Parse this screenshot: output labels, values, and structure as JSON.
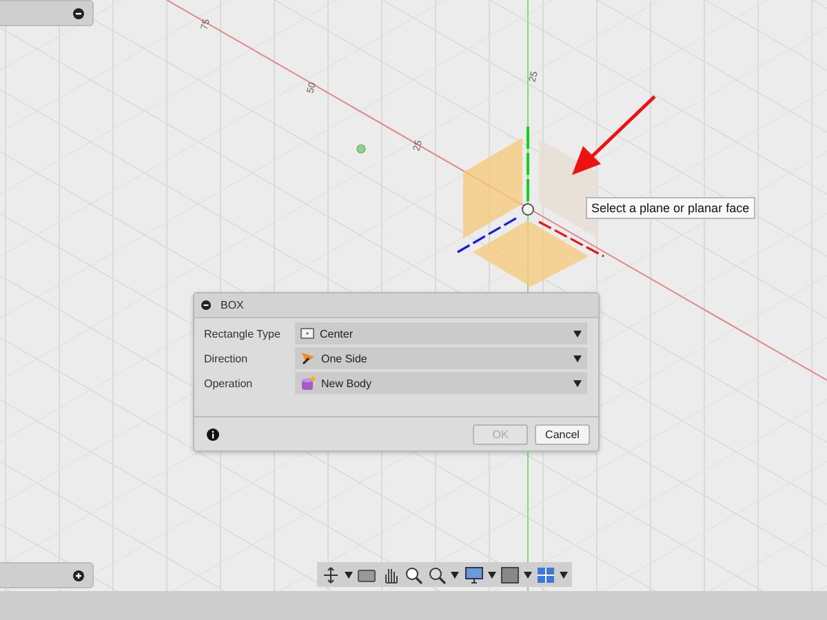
{
  "canvas": {
    "axis_labels": [
      "75",
      "50",
      "25",
      "25"
    ]
  },
  "tooltip": {
    "text": "Select a plane or planar face"
  },
  "dialog": {
    "title": "BOX",
    "fields": [
      {
        "label": "Rectangle Type",
        "value": "Center",
        "kind": "rectangle"
      },
      {
        "label": "Direction",
        "value": "One Side",
        "kind": "direction"
      },
      {
        "label": "Operation",
        "value": "New Body",
        "kind": "body"
      }
    ],
    "buttons": [
      {
        "label": "OK",
        "disabled": true
      },
      {
        "label": "Cancel",
        "disabled": false
      }
    ]
  }
}
